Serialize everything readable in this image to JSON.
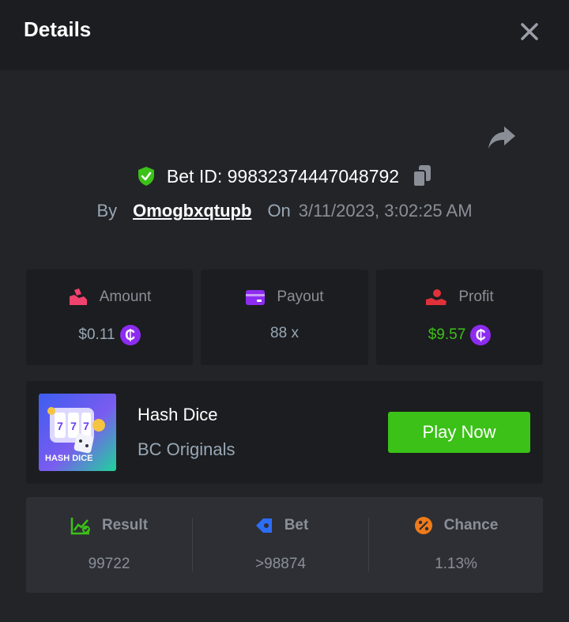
{
  "header": {
    "title": "Details"
  },
  "bet": {
    "id_label": "Bet ID: 99832374447048792",
    "by_label": "By",
    "user": "Omogbxqtupb",
    "on_label": "On",
    "date": "3/11/2023, 3:02:25 AM"
  },
  "stats": {
    "amount": {
      "label": "Amount",
      "value": "$0.11"
    },
    "payout": {
      "label": "Payout",
      "value": "88 x"
    },
    "profit": {
      "label": "Profit",
      "value": "$9.57"
    },
    "coin_symbol": "₵"
  },
  "game": {
    "thumb_text": "HASH DICE",
    "name": "Hash Dice",
    "provider": "BC Originals",
    "play_label": "Play Now"
  },
  "result": {
    "result": {
      "label": "Result",
      "value": "99722"
    },
    "bet": {
      "label": "Bet",
      "value": ">98874"
    },
    "chance": {
      "label": "Chance",
      "value": "1.13%"
    }
  },
  "colors": {
    "accent_green": "#3bc117",
    "profit_green": "#3bc117",
    "coin_purple": "#8d2cf0",
    "amount_pink": "#f0426e",
    "payout_purple": "#8d2cf0",
    "profit_red": "#e0313a",
    "bet_blue": "#2d6df6",
    "chance_orange": "#f07a1a"
  },
  "icons": {
    "close": "close-icon",
    "share": "share-icon",
    "verified": "shield-check-icon",
    "copy": "copy-icon",
    "amount": "money-hand-icon",
    "payout": "wallet-icon",
    "profit": "profit-hand-icon",
    "result": "chart-check-icon",
    "bet": "ticket-icon",
    "chance": "percent-icon"
  }
}
